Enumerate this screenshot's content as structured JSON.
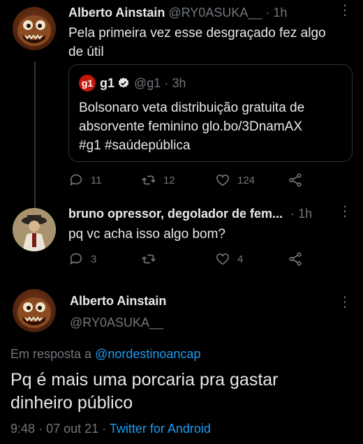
{
  "tweet1": {
    "name": "Alberto Ainstain",
    "handle": "@RY0ASUKA__",
    "sep": "·",
    "time": "1h",
    "text_line1": "Pela primeira vez esse desgraçado fez algo",
    "text_line2": "de útil",
    "quote": {
      "logo": "g1",
      "name": "g1",
      "handle": "@g1",
      "sep": "·",
      "time": "3h",
      "line1": "Bolsonaro veta distribuição gratuita de",
      "line2": "absorvente feminino glo.bo/3DnamAX",
      "line3": "#g1 #saúdepública"
    },
    "replies": "11",
    "retweets": "12",
    "likes": "124"
  },
  "tweet2": {
    "name": "bruno opressor, degolador de fem...",
    "sep": "·",
    "time": "1h",
    "text": "pq vc acha isso algo bom?",
    "replies": "3",
    "likes": "4"
  },
  "main": {
    "name": "Alberto Ainstain",
    "handle": "@RY0ASUKA__",
    "reply_prefix": "Em resposta a",
    "reply_handle": "@nordestinoancap",
    "text_line1": "Pq é mais uma porcaria pra gastar",
    "text_line2": "dinheiro público",
    "time": "9:48",
    "sep1": "·",
    "date": "07 out 21",
    "sep2": "·",
    "source": "Twitter for Android"
  },
  "colors": {
    "accent": "#1d9bf0",
    "muted": "#71767b",
    "g1_red": "#c4170c"
  }
}
